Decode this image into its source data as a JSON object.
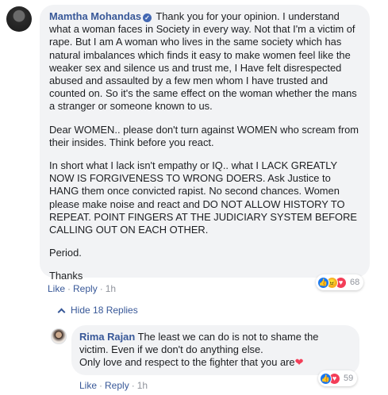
{
  "comment": {
    "author": "Mamtha Mohandas",
    "verified_icon": "verified-badge-icon",
    "paragraphs": [
      "Thank you for your opinion. I understand what a woman faces in Society in every way. Not that I'm a victim of rape. But I am A woman who lives in the same society which has natural imbalances which finds it easy to make women feel like the weaker sex and silence us and trust me, I Have felt disrespected abused and assaulted by a few men whom I have trusted and counted on. So it's the same effect on the woman whether the mans a stranger or someone known to us.",
      "Dear WOMEN.. please don't turn against WOMEN who scream from their insides. Think before you react.",
      "In short what I lack isn't empathy or IQ.. what I LACK GREATLY NOW IS FORGIVENESS TO WRONG DOERS. Ask Justice to HANG them once convicted rapist. No second chances. Women please make noise and react and DO NOT ALLOW HISTORY TO REPEAT. POINT FINGERS AT THE JUDICIARY SYSTEM BEFORE CALLING OUT ON EACH OTHER.",
      "Period.",
      "Thanks"
    ],
    "actions": {
      "like": "Like",
      "reply": "Reply",
      "time": "1h"
    },
    "reactions": {
      "count": "68",
      "icons": [
        "like-reaction-icon",
        "angry-reaction-icon",
        "love-reaction-icon"
      ]
    }
  },
  "hide_replies": "Hide 18 Replies",
  "reply": {
    "author": "Rima Rajan",
    "text_line1": "The least we can do is not to shame the victim. Even if we don't do anything else.",
    "text_line2": "Only love and respect to the fighter that you are",
    "actions": {
      "like": "Like",
      "reply": "Reply",
      "time": "1h"
    },
    "reactions": {
      "count": "59",
      "icons": [
        "like-reaction-icon",
        "love-reaction-icon"
      ]
    }
  },
  "colors": {
    "link": "#385898",
    "bubble": "#f2f3f5",
    "muted": "#90949c"
  }
}
